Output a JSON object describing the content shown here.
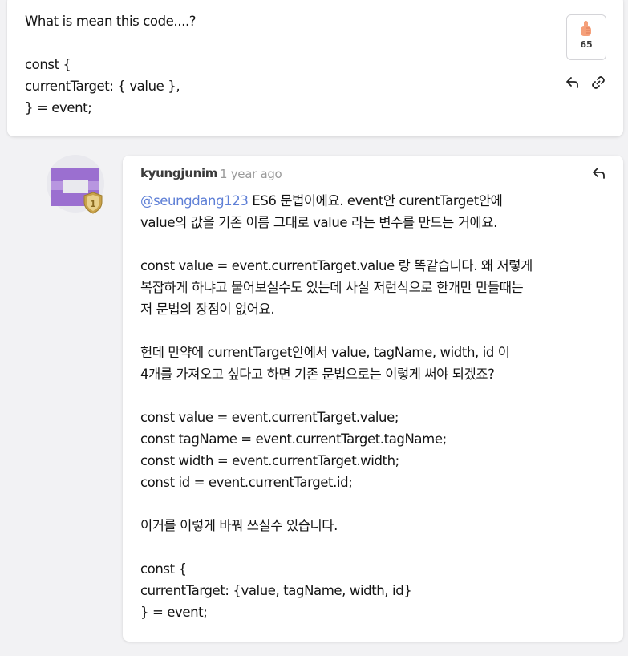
{
  "question": {
    "lines": [
      "What is mean this code....?",
      "",
      "const {",
      "currentTarget: { value },",
      "} = event;"
    ],
    "like_count": "65"
  },
  "reply": {
    "author": "kyungjunim",
    "timestamp": "1 year ago",
    "mention": "@seungdang123",
    "first_line_rest": " ES6 문법이에요. event안 curentTarget안에",
    "lines": [
      "value의 값을 기존 이름 그대로 value 라는 변수를 만드는 거에요.",
      "",
      "const value = event.currentTarget.value 랑 똑같습니다. 왜 저렇게",
      "복잡하게 하냐고 물어보실수도 있는데 사실 저런식으로 한개만 만들때는",
      "저 문법의 장점이 없어요.",
      "",
      "헌데 만약에 currentTarget안에서 value, tagName, width, id 이",
      "4개를 가져오고 싶다고 하면 기존 문법으로는 이렇게 써야 되겠죠?",
      "",
      "const value = event.currentTarget.value;",
      "const tagName = event.currentTarget.tagName;",
      "const width = event.currentTarget.width;",
      "const id = event.currentTarget.id;",
      "",
      "이거를 이렇게 바꿔 쓰실수 있습니다.",
      "",
      "const {",
      "currentTarget: {value, tagName, width, id}",
      "} = event;"
    ],
    "badge_number": "1"
  },
  "icons": {
    "like": "thumbs-up-icon",
    "reply": "reply-arrow-icon",
    "link": "link-icon",
    "badge": "shield-badge-icon"
  },
  "colors": {
    "mention": "#5e7fd6",
    "avatar": "#9b6fd0",
    "badge": "#c9a24a",
    "like": "#f5a07a"
  }
}
